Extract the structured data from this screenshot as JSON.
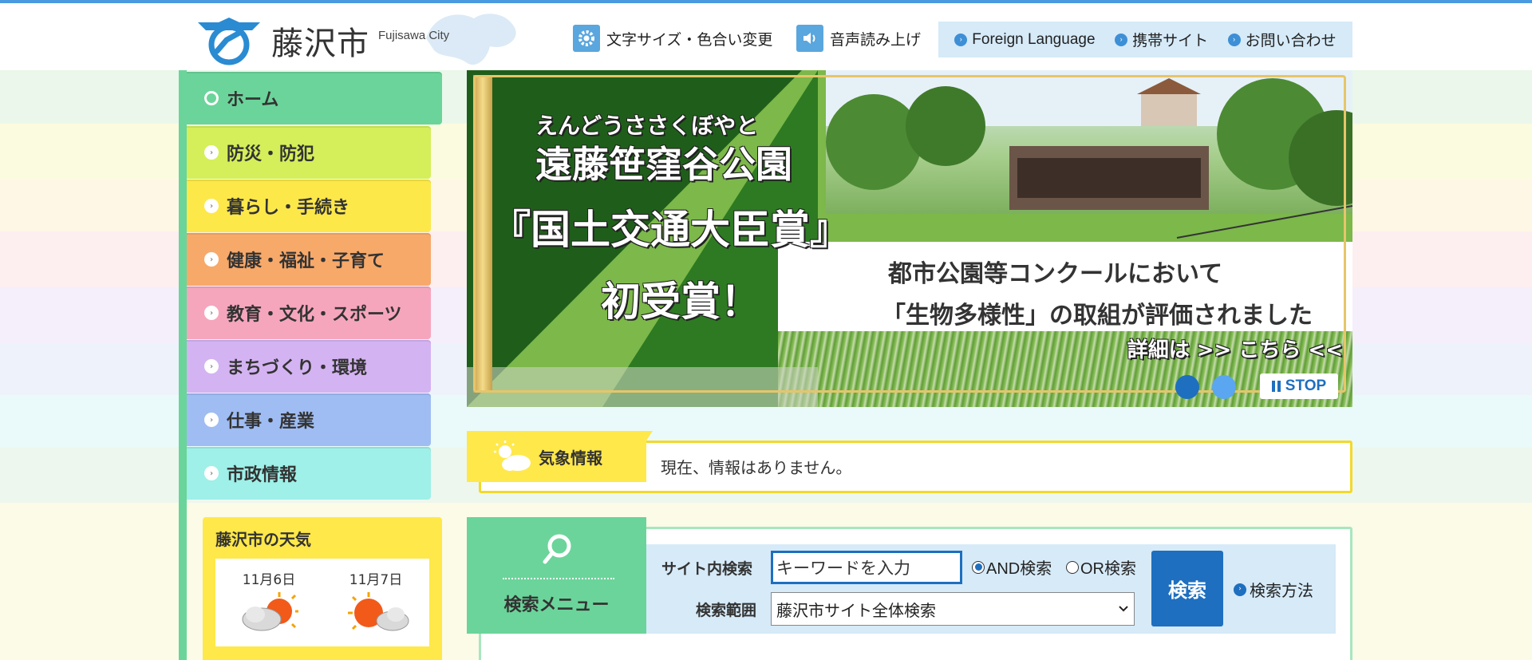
{
  "header": {
    "logo_text": "藤沢市",
    "logo_sub": "Fujisawa City",
    "tool_text_size": "文字サイズ・色合い変更",
    "tool_voice": "音声読み上げ",
    "links": [
      "Foreign Language",
      "携帯サイト",
      "お問い合わせ"
    ],
    "accent_color": "#4a9ae0"
  },
  "nav": {
    "items": [
      {
        "label": "ホーム",
        "color": "#6bd49a"
      },
      {
        "label": "防災・防犯",
        "color": "#d4ef5a"
      },
      {
        "label": "暮らし・手続き",
        "color": "#fde84a"
      },
      {
        "label": "健康・福祉・子育て",
        "color": "#f7a96a"
      },
      {
        "label": "教育・文化・スポーツ",
        "color": "#f5a6bd"
      },
      {
        "label": "まちづくり・環境",
        "color": "#d4b3f2"
      },
      {
        "label": "仕事・産業",
        "color": "#9fbdf3"
      },
      {
        "label": "市政情報",
        "color": "#9ef0e8"
      }
    ]
  },
  "weather": {
    "title": "藤沢市の天気",
    "days": [
      {
        "date": "11月6日",
        "icon": "cloud-sun-icon"
      },
      {
        "date": "11月7日",
        "icon": "sun-cloud-icon"
      }
    ]
  },
  "hero": {
    "line1": "えんどうささくぼやと",
    "line2": "遠藤笹窪谷公園",
    "line3": "『国土交通大臣賞』",
    "line4": "初受賞！",
    "panel_line1": "都市公園等コンクールにおいて",
    "panel_line2": "「生物多様性」の取組が評価されました",
    "detail": "詳細は >> こちら <<",
    "stop_label": "STOP"
  },
  "kisho": {
    "tab_label": "気象情報",
    "message": "現在、情報はありません。"
  },
  "search": {
    "tab_label": "検索メニュー",
    "site_search_label": "サイト内検索",
    "input_placeholder": "キーワードを入力",
    "radio_and": "AND検索",
    "radio_or": "OR検索",
    "scope_label": "検索範囲",
    "scope_value": "藤沢市サイト全体検索",
    "button_label": "検索",
    "howto_label": "検索方法"
  }
}
